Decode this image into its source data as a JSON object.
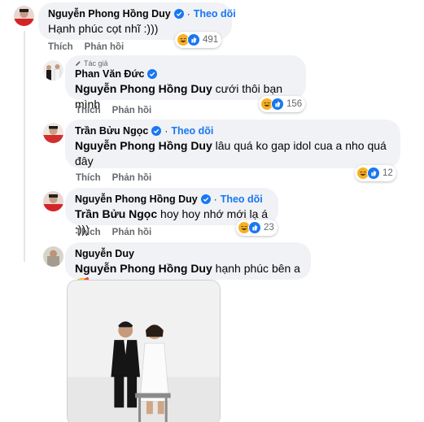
{
  "comments": [
    {
      "author": "Nguyễn Phong Hồng Duy",
      "follow": "Theo dõi",
      "text": "Hạnh phúc cọt nhĩ :)))",
      "reaction_count": "491",
      "actions": {
        "like": "Thích",
        "reply": "Phản hồi"
      }
    },
    {
      "author_tag": "Tác giả",
      "author": "Phan Văn Đức",
      "mention": "Nguyễn Phong Hồng Duy",
      "text": " cưới thôi bạn mình",
      "reaction_count": "156",
      "actions": {
        "like": "Thích",
        "reply": "Phản hồi"
      }
    },
    {
      "author": "Trần Bửu Ngọc",
      "follow": "Theo dõi",
      "mention": "Nguyễn Phong Hồng Duy",
      "text": " lâu quá ko gap idol cua a nho quá đây",
      "reaction_count": "12",
      "actions": {
        "like": "Thích",
        "reply": "Phản hồi"
      }
    },
    {
      "author": "Nguyễn Phong Hồng Duy",
      "follow": "Theo dõi",
      "mention": "Trần Bửu Ngọc",
      "text": " hoy hoy nhớ mới lạ á :)))",
      "reaction_count": "23",
      "actions": {
        "like": "Thích",
        "reply": "Phản hồi"
      }
    },
    {
      "author": "Nguyễn Duy",
      "mention": "Nguyễn Phong Hồng Duy",
      "text": " hạnh phúc bên a",
      "emoji": "🥰"
    }
  ],
  "colors": {
    "bubble": "#f0f2f5",
    "link": "#1877f2",
    "muted": "#65676b",
    "haha": "#f7b125",
    "like": "#1877f2"
  },
  "icons": [
    "verified-badge-icon",
    "haha-reaction-icon",
    "like-reaction-icon",
    "pencil-icon"
  ]
}
